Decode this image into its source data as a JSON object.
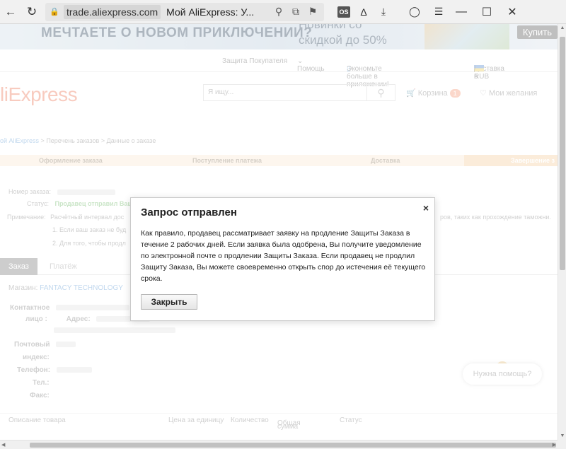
{
  "browser": {
    "url_domain": "trade.aliexpress.com",
    "page_title": "Мой AliExpress: У...",
    "ext_os_label": "OS"
  },
  "banner": {
    "text_left": "МЕЧТАЕТЕ О НОВОМ ПРИКЛЮЧЕНИИ?",
    "text_right_1": "Новинки со",
    "text_right_2": "скидкой до 50%",
    "buy_label": "Купить"
  },
  "topbar": {
    "buyer_protection": "Защита Покупателя",
    "help": "Помощь",
    "app_promo": "Экономьте больше в приложении!",
    "delivery": "Доставка в",
    "currency": "/ RUB"
  },
  "header": {
    "logo": "liExpress",
    "search_placeholder": "Я ищу...",
    "cart_label": "Корзина",
    "cart_count": "1",
    "wishlist_label": "Мои желания"
  },
  "breadcrumb": {
    "home": "ой AliExpress",
    "sep1": " > ",
    "orders": "Перечень заказов",
    "sep2": " > ",
    "current": "Данные о заказе"
  },
  "steps": [
    "Оформление заказа",
    "Поступление платежа",
    "Доставка",
    "Завершение з"
  ],
  "order": {
    "number_label": "Номер заказа:",
    "status_label": "Статус:",
    "status_value": "Продавец отправил Ваш",
    "note_label": "Примечание:",
    "note_text": "Расчётный интервал дос",
    "note_tail": "ров, таких как прохождение таможни.",
    "note_1": "1. Если ваш заказ не буд",
    "note_2": "2. Для того, чтобы продл"
  },
  "tabs": [
    "Заказ",
    "Платёж"
  ],
  "shop": {
    "label": "Магазин:",
    "name": "FANTACY TECHNOLOGY"
  },
  "contact": {
    "contact_label_1": "Контактное",
    "contact_label_2": "лицо :",
    "address_label": "Адрес:",
    "postal_label_1": "Почтовый",
    "postal_label_2": "индекс:",
    "phone_label": "Телефон:",
    "tel_label": "Тел.:",
    "fax_label": "Факс:"
  },
  "table_head": {
    "desc": "Описание товара",
    "unit_price": "Цена за единицу",
    "qty": "Количество",
    "total_1": "Общая",
    "total_2": "сумма",
    "status": "Статус"
  },
  "help_label": "Нужна помощь?",
  "modal": {
    "title": "Запрос отправлен",
    "close_glyph": "×",
    "body": "Как правило, продавец рассматривает заявку на продление Защиты Заказа в течение 2 рабочих дней. Если заявка была одобрена, Вы получите уведомление по электронной почте о продлении Защиты Заказа. Если продавец не продлил Защиту Заказа, Вы можете своевременно открыть спор до истечения её текущего срока.",
    "button_label": "Закрыть"
  },
  "colors": {
    "accent": "#f2a08a",
    "link": "#8fb8e0",
    "status_green": "#9ecf9a"
  }
}
